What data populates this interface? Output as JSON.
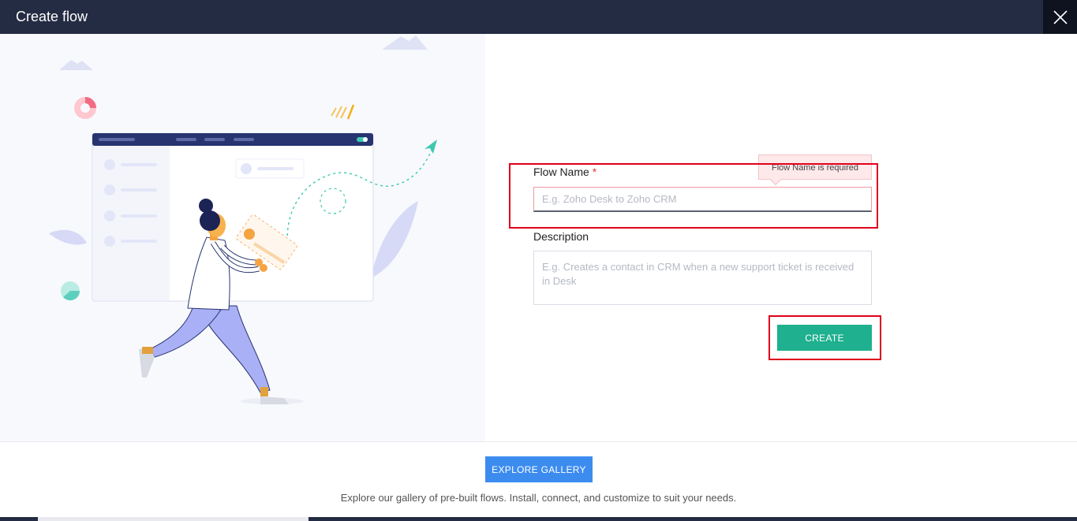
{
  "header": {
    "title": "Create flow",
    "close_icon": "close-icon"
  },
  "form": {
    "flow_name_label": "Flow Name",
    "required_marker": "*",
    "flow_name_placeholder": "E.g. Zoho Desk to Zoho CRM",
    "flow_name_value": "",
    "error_tooltip": "Flow Name is required",
    "description_label": "Description",
    "description_placeholder": "E.g. Creates a contact in CRM when a new support ticket is received in Desk",
    "create_label": "CREATE"
  },
  "footer": {
    "explore_label": "EXPLORE GALLERY",
    "explore_text": "Explore our gallery of pre-built flows. Install, connect, and customize to suit your needs."
  },
  "colors": {
    "header_bg": "#242c43",
    "create_button": "#1fb08f",
    "explore_button": "#3c8cf0",
    "highlight_border": "#e0001b",
    "error_bg": "#fde8ea"
  }
}
